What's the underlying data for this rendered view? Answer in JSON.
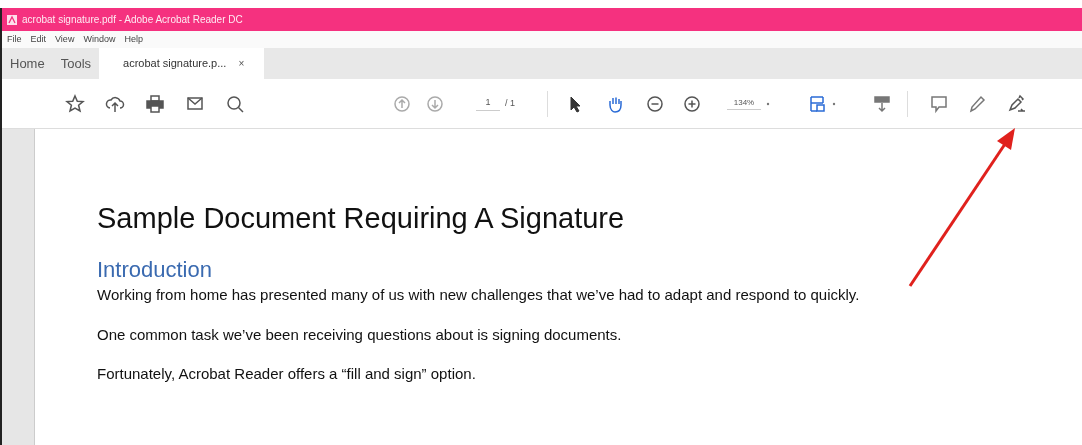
{
  "window": {
    "title": "acrobat signature.pdf - Adobe Acrobat Reader DC"
  },
  "menu": [
    "File",
    "Edit",
    "View",
    "Window",
    "Help"
  ],
  "tabs": [
    {
      "label": "Home",
      "selected": false
    },
    {
      "label": "Tools",
      "selected": false
    },
    {
      "label": "acrobat signature.p...",
      "selected": true,
      "close": "×"
    }
  ],
  "toolbar": {
    "page_number": "1",
    "page_total": "/ 1",
    "zoom": "134%",
    "hand_tool_selected": true
  },
  "document": {
    "title": "Sample Document Requiring A Signature",
    "heading": "Introduction",
    "paragraphs": [
      "Working from home has presented many of us with new challenges that we’ve had to adapt and respond to quickly.",
      "One common task we’ve been receiving questions about is signing documents.",
      "Fortunately, Acrobat Reader offers a “fill and sign” option."
    ]
  }
}
